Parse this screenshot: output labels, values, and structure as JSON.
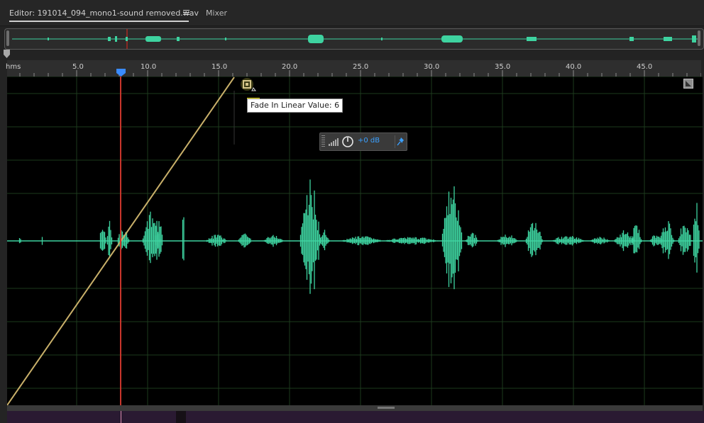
{
  "tabs": {
    "editor_label": "Editor: 191014_094_mono1-sound removed.wav",
    "mixer_label": "Mixer"
  },
  "ruler": {
    "unit": "hms",
    "labels": [
      "5.0",
      "10.0",
      "15.0",
      "20.0",
      "25.0",
      "30.0",
      "35.0",
      "40.0",
      "45.0"
    ]
  },
  "tooltip": {
    "text": "Fade In Linear Value: 6"
  },
  "hud": {
    "volume_value": "+0 dB"
  },
  "icons": {
    "menu": "hamburger-menu-icon",
    "knob": "volume-knob-icon",
    "pin": "pin-icon",
    "meter": "level-meter-icon",
    "fade": "fade-handle-icon",
    "corner": "zoom-corner-icon"
  },
  "colors": {
    "waveform": "#3ed3a0",
    "fade_line": "#c9b06a",
    "playhead": "#c8352b",
    "accent_blue": "#3aa0ff",
    "tooltip_highlight": "#f2e800"
  }
}
